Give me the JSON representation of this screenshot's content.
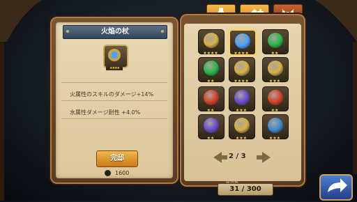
{
  "detail": {
    "title": "火焔の杖",
    "stars": "★★★★",
    "stat1": "火属性のスキルのダメージ+14%",
    "stat2": "水属性ダメージ耐性 +4.0%",
    "confirm_label": "完邸",
    "cost": "1600"
  },
  "pager": {
    "text": "2 / 3"
  },
  "counter": {
    "label": "所持数",
    "value": "31 / 300"
  },
  "slots": [
    {
      "stars": "★★★★",
      "color": "#d9b14a"
    },
    {
      "stars": "★★★★",
      "color": "#4aa3ff"
    },
    {
      "stars": "★★",
      "color": "#28b84a"
    },
    {
      "stars": "★★",
      "color": "#28b84a"
    },
    {
      "stars": "★★★★",
      "color": "#d9b14a"
    },
    {
      "stars": "★★★",
      "color": "#d9b14a"
    },
    {
      "stars": "★★",
      "color": "#d6412a"
    },
    {
      "stars": "★★★",
      "color": "#6a4bd6"
    },
    {
      "stars": "★★",
      "color": "#d6412a"
    },
    {
      "stars": "★★",
      "color": "#6a4bd6"
    },
    {
      "stars": "★★★",
      "color": "#d9b14a"
    },
    {
      "stars": "★★★",
      "color": "#3b8ad6"
    }
  ]
}
